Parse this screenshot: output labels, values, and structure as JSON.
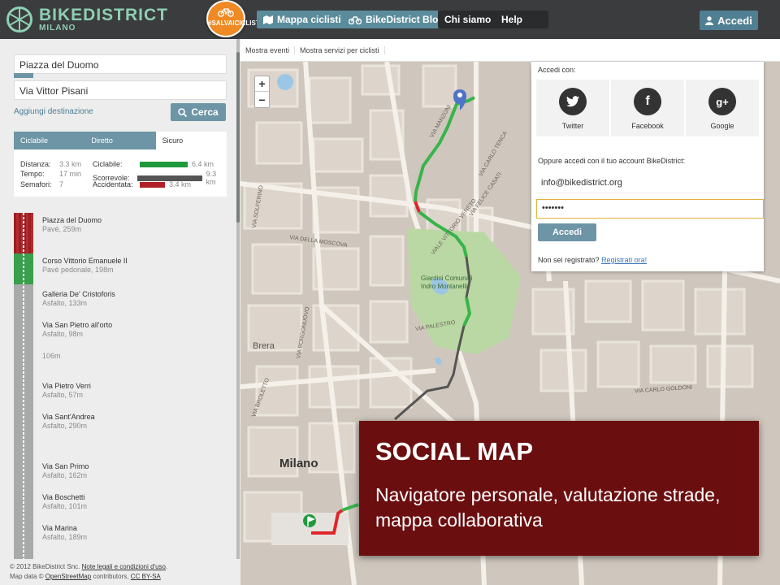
{
  "brand": {
    "title": "BIKEDISTRICT",
    "subtitle": "MILANO",
    "badge_text": "#SALVAICICLISTI"
  },
  "nav": {
    "items": [
      "Mappa ciclisti",
      "BikeDistrict Blog",
      "Chi siamo",
      "Help"
    ],
    "login_label": "Accedi"
  },
  "route_form": {
    "from": "Piazza del Duomo",
    "to": "Via Vittor Pisani",
    "add_destination": "Aggiungi destinazione",
    "search_label": "Cerca"
  },
  "route_tabs": [
    "Ciclabile",
    "Diretto",
    "Sicuro"
  ],
  "stats": {
    "rows": [
      {
        "label": "Distanza:",
        "value": "3.3 km"
      },
      {
        "label": "Tempo:",
        "value": "17 min"
      },
      {
        "label": "Semafori:",
        "value": "7"
      }
    ],
    "bars": [
      {
        "label": "Ciclabile:",
        "value": "6.4 km",
        "color": "#1e9a3c",
        "ratio": 0.69
      },
      {
        "label": "Scorrevole:",
        "value": "9.3 km",
        "color": "#555555",
        "ratio": 1.0
      },
      {
        "label": "Accidentata:",
        "value": "3.4 km",
        "color": "#b02127",
        "ratio": 0.37
      }
    ]
  },
  "route_steps": [
    {
      "name": "Piazza del Duomo",
      "detail": "Pavé, 259m"
    },
    {
      "name": "Corso Vittorio Emanuele II",
      "detail": "Pavé pedonale, 198m"
    },
    {
      "name": "Galleria De' Cristoforis",
      "detail": "Asfalto, 133m"
    },
    {
      "name": "Via San Pietro all'orto",
      "detail": "Asfalto, 98m"
    },
    {
      "name": "106m",
      "detail": ""
    },
    {
      "name": "Via Pietro Verri",
      "detail": "Asfalto, 57m"
    },
    {
      "name": "Via Sant'Andrea",
      "detail": "Asfalto, 290m"
    },
    {
      "name": "Via San Primo",
      "detail": "Asfalto, 162m"
    },
    {
      "name": "Via Boschetti",
      "detail": "Asfalto, 101m"
    },
    {
      "name": "Via Marina",
      "detail": "Asfalto, 189m"
    }
  ],
  "footer": {
    "line1_prefix": "© 2012 BikeDistrict Snc.",
    "line1_link": "Note legali e condizioni d'uso",
    "line2_prefix": "Map data ©",
    "line2_link": "OpenStreetMap",
    "line2_mid": "contributors,",
    "line2_license": "CC BY-SA"
  },
  "map_toolbar": [
    "Mostra eventi",
    "Mostra servizi per ciclisti"
  ],
  "map_labels": {
    "city": "Milano",
    "park": "Giardini Comunali Indro Montanelli",
    "brera": "Brera",
    "streets": [
      "VIA DELLA MOSCOVA",
      "VIA MANZONI",
      "VIALE VITTORIO VENETO",
      "VIA PALESTRO",
      "VIA CARLO TENCA",
      "VIA FELICE CASATI",
      "VIA CARLO GOLDONI",
      "VIA SOLFERINO",
      "VIA BORGONUOVO",
      "VIA BROLETTO"
    ]
  },
  "login_popup": {
    "title": "Accedi con:",
    "providers": [
      {
        "name": "Twitter",
        "icon": "twitter-icon",
        "glyph": "t"
      },
      {
        "name": "Facebook",
        "icon": "facebook-icon",
        "glyph": "f"
      },
      {
        "name": "Google",
        "icon": "google-plus-icon",
        "glyph": "g+"
      }
    ],
    "subtitle": "Oppure accedi con il tuo account BikeDistrict:",
    "email": "info@bikedistrict.org",
    "password_mask": "•••••••",
    "submit": "Accedi",
    "register_prefix": "Non sei registrato?",
    "register_link": "Registrati ora!"
  },
  "overlay": {
    "title": "SOCIAL MAP",
    "body": "Navigatore personale, valutazione strade, mappa collaborativa"
  },
  "colors": {
    "teal": "#6d95a5",
    "topbar": "#3a3c3e",
    "overlay": "#6b0e0f",
    "route_green": "#38b44a",
    "route_dark": "#555555",
    "route_red": "#e0262b"
  }
}
